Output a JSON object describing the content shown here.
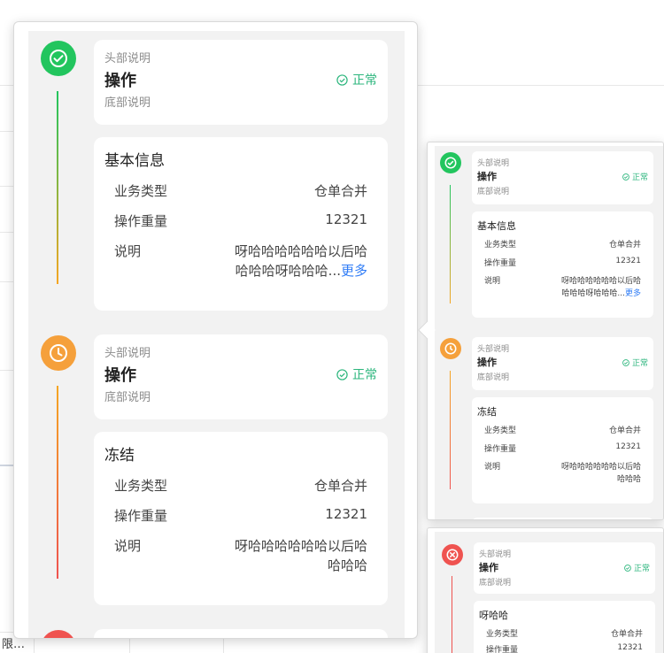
{
  "background": {
    "partial_text": "限…"
  },
  "status_label": "正常",
  "more_link": "更多",
  "items": [
    {
      "header": {
        "desc": "头部说明",
        "title": "操作",
        "foot": "底部说明"
      },
      "detail": {
        "title": "基本信息",
        "rows": [
          {
            "key": "业务类型",
            "value": "仓单合并"
          },
          {
            "key": "操作重量",
            "value": "12321"
          },
          {
            "key": "说明",
            "value_line1": "呀哈哈哈哈哈哈以后哈",
            "value_line2": "哈哈哈呀哈哈哈..."
          }
        ]
      },
      "node_color": "#22c55e",
      "node_icon": "check-circle-icon"
    },
    {
      "header": {
        "desc": "头部说明",
        "title": "操作",
        "foot": "底部说明"
      },
      "detail": {
        "title": "冻结",
        "rows": [
          {
            "key": "业务类型",
            "value": "仓单合并"
          },
          {
            "key": "操作重量",
            "value": "12321"
          },
          {
            "key": "说明",
            "value_line1": "呀哈哈哈哈哈哈以后哈",
            "value_line2": "哈哈哈"
          }
        ]
      },
      "node_color": "#f59e3b",
      "node_icon": "clock-icon"
    },
    {
      "header": {
        "desc": "头部说明",
        "title": "操作",
        "foot": "底部说明"
      },
      "detail": {
        "title": "呀哈哈",
        "rows": [
          {
            "key": "业务类型",
            "value": "仓单合并"
          },
          {
            "key": "操作重量",
            "value": "12321"
          }
        ]
      },
      "node_color": "#ef5350",
      "node_icon": "close-circle-icon"
    }
  ]
}
